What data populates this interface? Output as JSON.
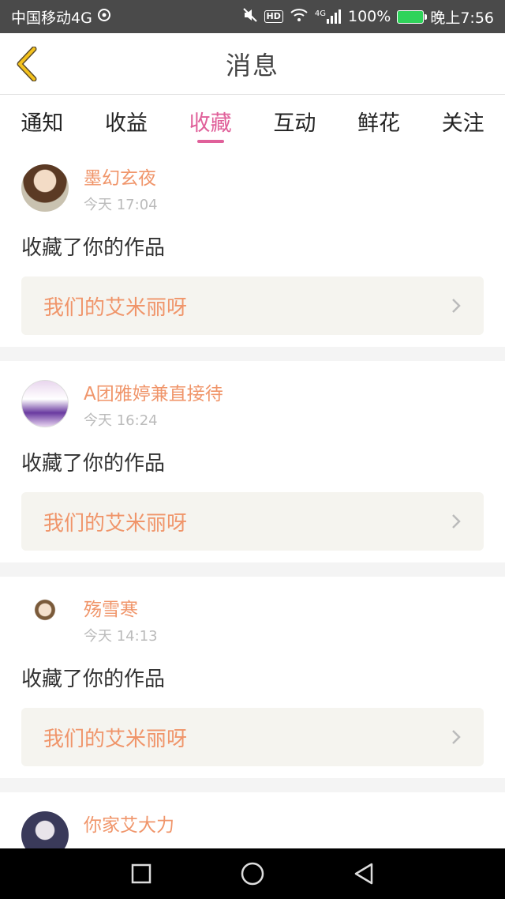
{
  "status_bar": {
    "carrier": "中国移动4G",
    "battery": "100%",
    "time": "晚上7:56",
    "hd": "HD",
    "network": "4G",
    "icons": [
      "sync-icon",
      "mute-icon",
      "wifi-icon",
      "signal-icon",
      "battery-icon"
    ]
  },
  "header": {
    "title": "消息",
    "back_icon": "back-chevron-icon"
  },
  "tabs": [
    {
      "label": "通知",
      "active": false
    },
    {
      "label": "收益",
      "active": false
    },
    {
      "label": "收藏",
      "active": true
    },
    {
      "label": "互动",
      "active": false
    },
    {
      "label": "鲜花",
      "active": false
    },
    {
      "label": "关注",
      "active": false
    }
  ],
  "notifications": [
    {
      "username": "墨幻玄夜",
      "time": "今天 17:04",
      "action": "收藏了你的作品",
      "work_title": "我们的艾米丽呀"
    },
    {
      "username": "A团雅婷兼直接待",
      "time": "今天 16:24",
      "action": "收藏了你的作品",
      "work_title": "我们的艾米丽呀"
    },
    {
      "username": "殇雪寒",
      "time": "今天 14:13",
      "action": "收藏了你的作品",
      "work_title": "我们的艾米丽呀"
    },
    {
      "username": "你家艾大力"
    }
  ],
  "colors": {
    "accent_pink": "#e0609a",
    "orange_text": "#f0956a",
    "status_bar_bg": "#4a4a4a",
    "back_icon_yellow": "#f4c21c"
  },
  "system_nav": {
    "icons": [
      "recent-apps-icon",
      "home-icon",
      "back-icon"
    ]
  }
}
